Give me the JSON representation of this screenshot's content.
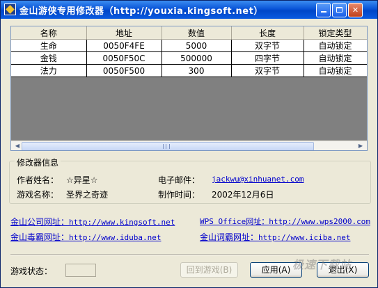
{
  "window": {
    "title": "金山游侠专用修改器（http://youxia.kingsoft.net）"
  },
  "grid": {
    "columns": [
      "名称",
      "地址",
      "数值",
      "长度",
      "锁定类型"
    ],
    "rows": [
      [
        "生命",
        "0050F4FE",
        "5000",
        "双字节",
        "自动锁定"
      ],
      [
        "金钱",
        "0050F50C",
        "500000",
        "四字节",
        "自动锁定"
      ],
      [
        "法力",
        "0050F500",
        "300",
        "双字节",
        "自动锁定"
      ]
    ]
  },
  "info": {
    "group_title": "修改器信息",
    "author_label": "作者姓名：",
    "author_value": "☆异星☆",
    "email_label": "电子邮件：",
    "email_value": "jackwu@xinhuanet.com",
    "game_label": "游戏名称：",
    "game_value": "圣界之奇迹",
    "date_label": "制作时间：",
    "date_value": "2002年12月6日"
  },
  "links": {
    "kingsoft_label": "金山公司网址：",
    "kingsoft_url": "http://www.kingsoft.net",
    "wps_label": "WPS Office网址：",
    "wps_url": "http://www.wps2000.com",
    "duba_label": "金山毒霸网址：",
    "duba_url": "http://www.iduba.net",
    "ciba_label": "金山词霸网址：",
    "ciba_url": "http://www.iciba.net"
  },
  "status": {
    "label": "游戏状态：",
    "value": ""
  },
  "buttons": {
    "back_to_game": "回到游戏(B)",
    "apply": "应用(A)",
    "exit": "退出(X)"
  },
  "watermark": "极速下载站"
}
